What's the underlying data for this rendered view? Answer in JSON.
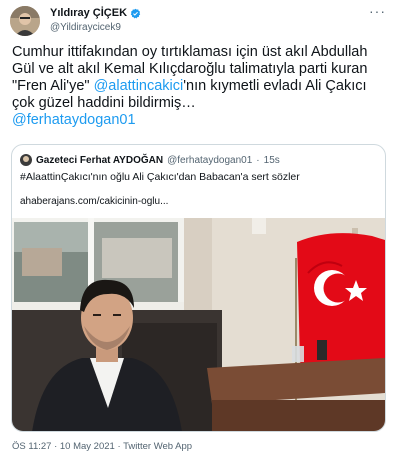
{
  "author": {
    "display_name": "Yıldıray ÇİÇEK",
    "handle": "@Yildiraycicek9"
  },
  "tweet": {
    "text_1": "Cumhur ittifakından oy tırtıklaması için üst akıl Abdullah Gül ve alt akıl Kemal Kılıçdaroğlu talimatıyla parti kuran \"Fren Ali'ye\" ",
    "mention_1": "@alattincakici",
    "text_2": "'nın kıymetli evladı Ali Çakıcı çok güzel haddini bildirmiş…",
    "mention_2": "@ferhataydogan01"
  },
  "quote": {
    "display_name": "Gazeteci Ferhat AYDOĞAN",
    "handle": "@ferhataydogan01",
    "separator": "·",
    "time": "15s",
    "text": "#AlaattinÇakıcı'nın oğlu Ali Çakıcı'dan Babacan'a sert sözler",
    "url": "ahaberajans.com/cakicinin-oglu..."
  },
  "meta": {
    "timestamp": "ÖS 11:27 · 10 May 2021 · Twitter Web App"
  },
  "colors": {
    "link": "#1d9bf0",
    "verified": "#1d9bf0",
    "flag": "#e30a17"
  }
}
